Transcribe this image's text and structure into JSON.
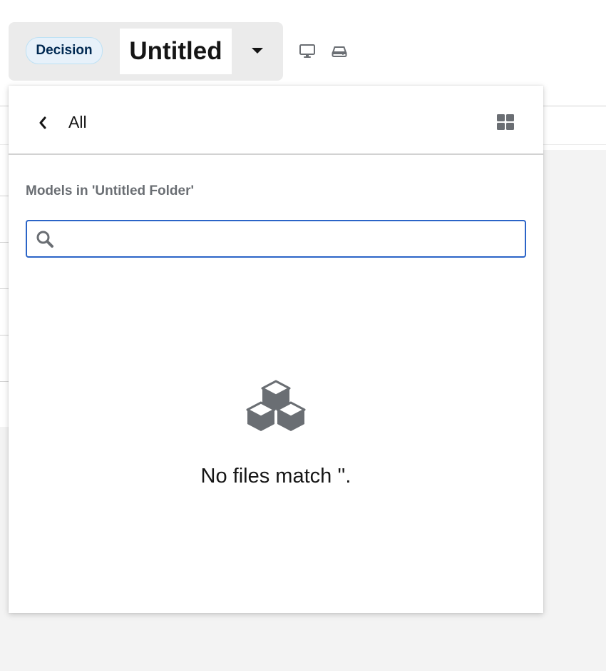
{
  "toolbar": {
    "badge_label": "Decision",
    "title": "Untitled",
    "icons": [
      "caret-down-icon",
      "desktop-icon",
      "hard-drive-icon"
    ]
  },
  "panel": {
    "back_label": "All",
    "icons": [
      "chevron-left-icon",
      "grid-view-icon",
      "search-icon",
      "cubes-icon"
    ],
    "section_label": "Models in 'Untitled Folder'",
    "search": {
      "value": "",
      "placeholder": ""
    },
    "empty_message": "No files match ''."
  },
  "colors": {
    "badge_bg": "#e7f1fa",
    "badge_text": "#002952",
    "search_border": "#2b64c7",
    "icon_gray": "#6a6e73"
  }
}
